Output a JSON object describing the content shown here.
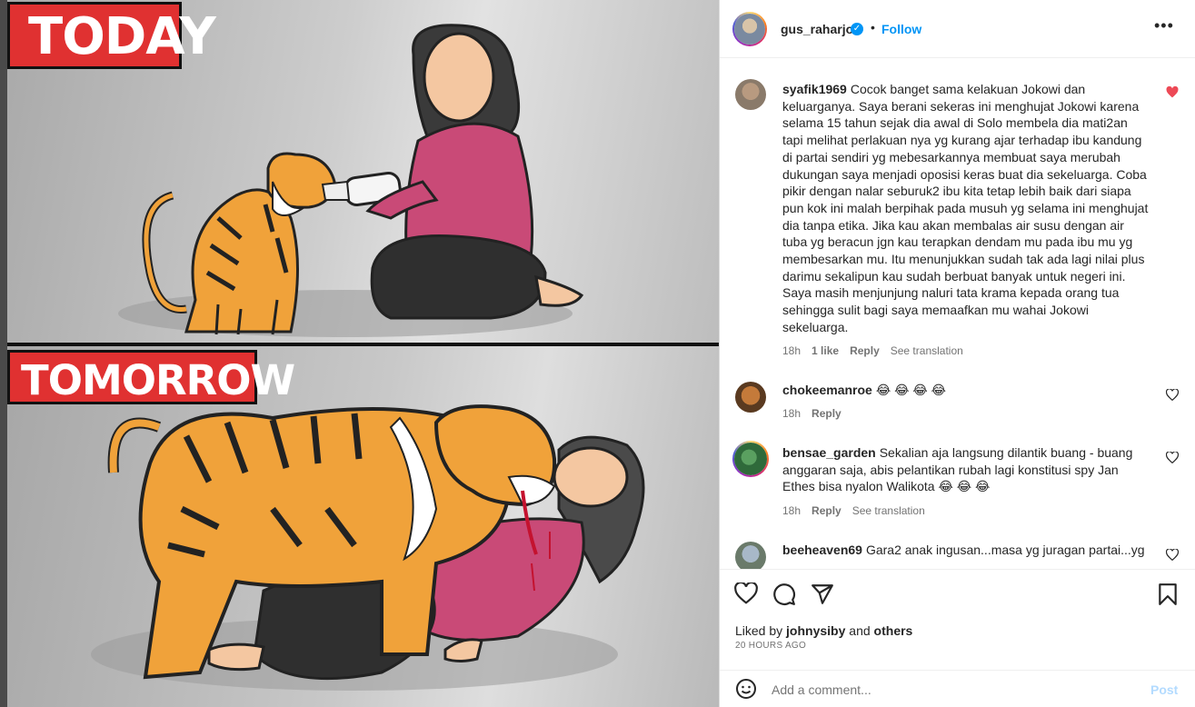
{
  "image": {
    "banner_top": "TODAY",
    "banner_bottom": "TOMORROW"
  },
  "header": {
    "username": "gus_raharjo",
    "separator": "•",
    "follow_label": "Follow",
    "more_label": "•••"
  },
  "comments": [
    {
      "username": "syafik1969",
      "text": "Cocok banget sama kelakuan Jokowi dan keluarganya. Saya berani sekeras ini menghujat Jokowi karena selama 15 tahun sejak dia awal di Solo membela dia mati2an tapi melihat perlakuan nya yg kurang ajar terhadap ibu kandung di partai sendiri yg mebesarkannya membuat saya merubah dukungan saya menjadi oposisi keras buat dia sekeluarga. Coba pikir dengan nalar seburuk2 ibu kita tetap lebih baik dari siapa pun kok ini malah berpihak pada musuh yg selama ini menghujat dia tanpa etika. Jika kau akan membalas air susu dengan air tuba yg beracun jgn kau terapkan dendam mu pada ibu mu yg membesarkan mu. Itu menunjukkan sudah tak ada lagi nilai plus darimu sekalipun kau sudah berbuat banyak untuk negeri ini. Saya masih menjunjung naluri tata krama kepada orang tua sehingga sulit bagi saya memaafkan mu wahai Jokowi sekeluarga.",
      "time": "18h",
      "likes": "1 like",
      "reply": "Reply",
      "translate": "See translation",
      "liked": true
    },
    {
      "username": "chokeemanroe",
      "text": "😂 😂 😂 😂",
      "time": "18h",
      "reply": "Reply"
    },
    {
      "username": "bensae_garden",
      "text": "Sekalian aja langsung dilantik buang - buang anggaran saja, abis pelantikan rubah lagi konstitusi spy Jan Ethes bisa nyalon Walikota 😂 😂 😂",
      "time": "18h",
      "reply": "Reply",
      "translate": "See translation"
    },
    {
      "username": "beeheaven69",
      "text": "Gara2 anak ingusan...masa yg juragan partai...yg"
    }
  ],
  "actions": {
    "liked_prefix": "Liked by",
    "liked_user": "johnysiby",
    "liked_and": "and",
    "liked_others": "others",
    "timestamp": "20 HOURS AGO"
  },
  "compose": {
    "placeholder": "Add a comment...",
    "post_label": "Post"
  },
  "colors": {
    "accent": "#0095f6",
    "like_red": "#ed4956",
    "banner_red": "#e03131"
  }
}
